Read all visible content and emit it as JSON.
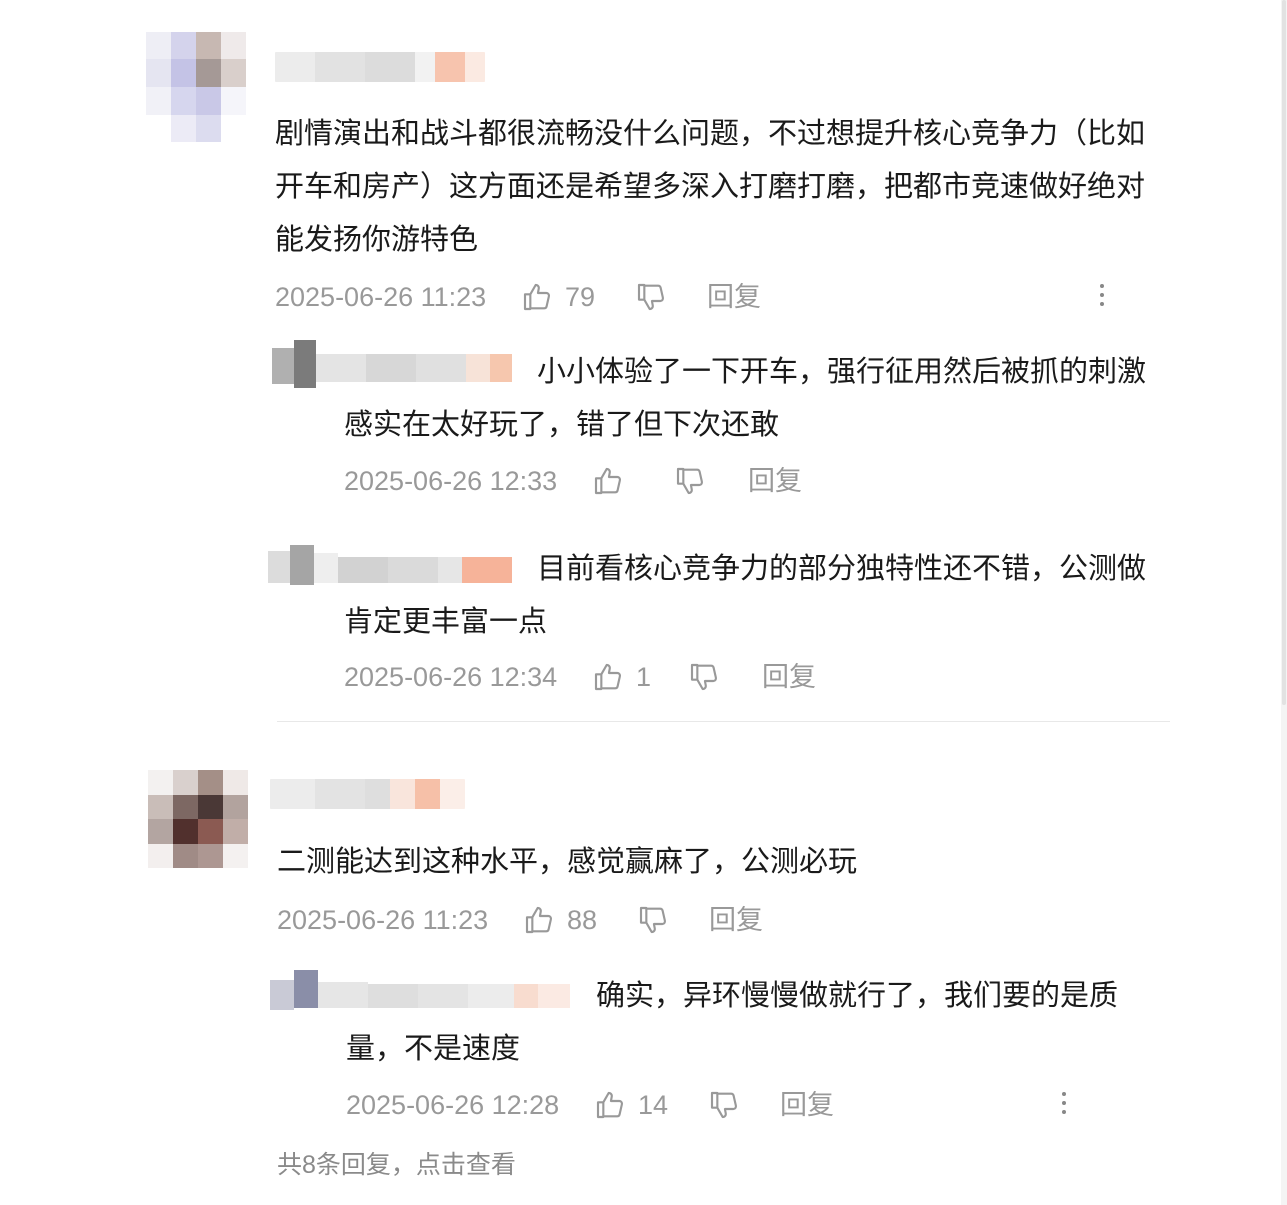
{
  "comments": [
    {
      "content": "剧情演出和战斗都很流畅没什么问题，不过想提升核心竞争力（比如开车和房产）这方面还是希望多深入打磨打磨，把都市竞速做好绝对能发扬你游特色",
      "time": "2025-06-26 11:23",
      "likes": "79",
      "reply_label": "回复",
      "replies": [
        {
          "text": "小小体验了一下开车，强行征用然后被抓的刺激感实在太好玩了，错了但下次还敢",
          "time": "2025-06-26 12:33",
          "likes": "",
          "reply_label": "回复"
        },
        {
          "text": "目前看核心竞争力的部分独特性还不错，公测做肯定更丰富一点",
          "time": "2025-06-26 12:34",
          "likes": "1",
          "reply_label": "回复"
        }
      ]
    },
    {
      "content": "二测能达到这种水平，感觉赢麻了，公测必玩",
      "time": "2025-06-26 11:23",
      "likes": "88",
      "reply_label": "回复",
      "replies": [
        {
          "text": "确实，异环慢慢做就行了，我们要的是质量，不是速度",
          "time": "2025-06-26 12:28",
          "likes": "14",
          "reply_label": "回复"
        }
      ],
      "view_all": "共8条回复，点击查看"
    }
  ],
  "icons": {
    "like": "thumbs-up-icon",
    "dislike": "thumbs-down-icon",
    "more": "more-vertical-icon"
  },
  "colors": {
    "text": "#1a1a1a",
    "meta": "#999999",
    "divider": "#e8e8e8"
  }
}
